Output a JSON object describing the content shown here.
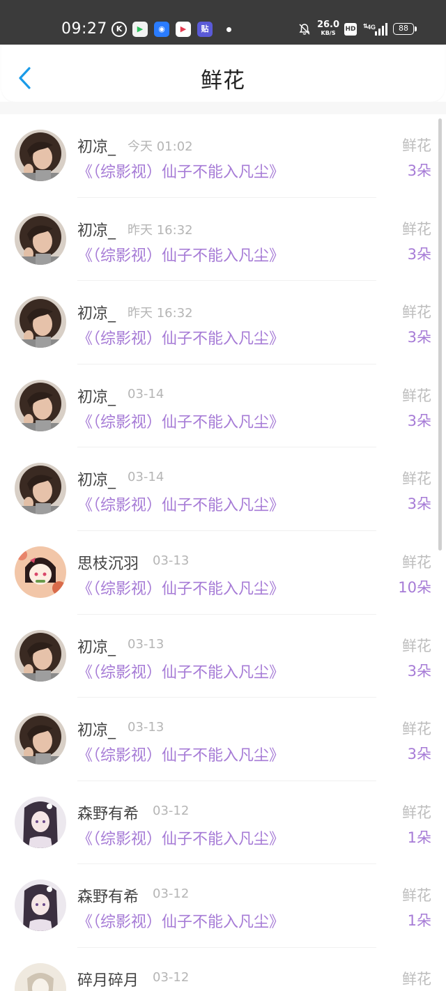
{
  "status_bar": {
    "time": "09:27",
    "notification_icons": [
      "k-app-icon",
      "play-store-icon",
      "browser-icon",
      "video-app-icon",
      "tieba-app-icon"
    ],
    "net_speed_value": "26.0",
    "net_speed_unit": "KB/S",
    "hd_label": "HD",
    "network_label": "4G",
    "battery": "88"
  },
  "header": {
    "back_icon": "chevron-left-icon",
    "title": "鲜花"
  },
  "colors": {
    "accent_purple": "#a67bd6",
    "back_blue": "#1a9be8",
    "muted_gray": "#b5b5b5",
    "status_bar_bg": "#3b3b3b"
  },
  "list": {
    "items": [
      {
        "username": "初凉_",
        "time": "今天 01:02",
        "book_title": "《（综影视）仙子不能入凡尘》",
        "gift_type": "鲜花",
        "gift_count": "3朵",
        "avatar": "photo-avatar"
      },
      {
        "username": "初凉_",
        "time": "昨天 16:32",
        "book_title": "《（综影视）仙子不能入凡尘》",
        "gift_type": "鲜花",
        "gift_count": "3朵",
        "avatar": "photo-avatar"
      },
      {
        "username": "初凉_",
        "time": "昨天 16:32",
        "book_title": "《（综影视）仙子不能入凡尘》",
        "gift_type": "鲜花",
        "gift_count": "3朵",
        "avatar": "photo-avatar"
      },
      {
        "username": "初凉_",
        "time": "03-14",
        "book_title": "《（综影视）仙子不能入凡尘》",
        "gift_type": "鲜花",
        "gift_count": "3朵",
        "avatar": "photo-avatar"
      },
      {
        "username": "初凉_",
        "time": "03-14",
        "book_title": "《（综影视）仙子不能入凡尘》",
        "gift_type": "鲜花",
        "gift_count": "3朵",
        "avatar": "photo-avatar"
      },
      {
        "username": "思枝沉羽",
        "time": "03-13",
        "book_title": "《（综影视）仙子不能入凡尘》",
        "gift_type": "鲜花",
        "gift_count": "10朵",
        "avatar": "anime-avatar"
      },
      {
        "username": "初凉_",
        "time": "03-13",
        "book_title": "《（综影视）仙子不能入凡尘》",
        "gift_type": "鲜花",
        "gift_count": "3朵",
        "avatar": "photo-avatar"
      },
      {
        "username": "初凉_",
        "time": "03-13",
        "book_title": "《（综影视）仙子不能入凡尘》",
        "gift_type": "鲜花",
        "gift_count": "3朵",
        "avatar": "photo-avatar"
      },
      {
        "username": "森野有希",
        "time": "03-12",
        "book_title": "《（综影视）仙子不能入凡尘》",
        "gift_type": "鲜花",
        "gift_count": "1朵",
        "avatar": "illustration-avatar"
      },
      {
        "username": "森野有希",
        "time": "03-12",
        "book_title": "《（综影视）仙子不能入凡尘》",
        "gift_type": "鲜花",
        "gift_count": "1朵",
        "avatar": "illustration-avatar"
      },
      {
        "username": "碎月碎月",
        "time": "03-12",
        "book_title": "",
        "gift_type": "鲜花",
        "gift_count": "",
        "avatar": "sketch-avatar"
      }
    ]
  }
}
